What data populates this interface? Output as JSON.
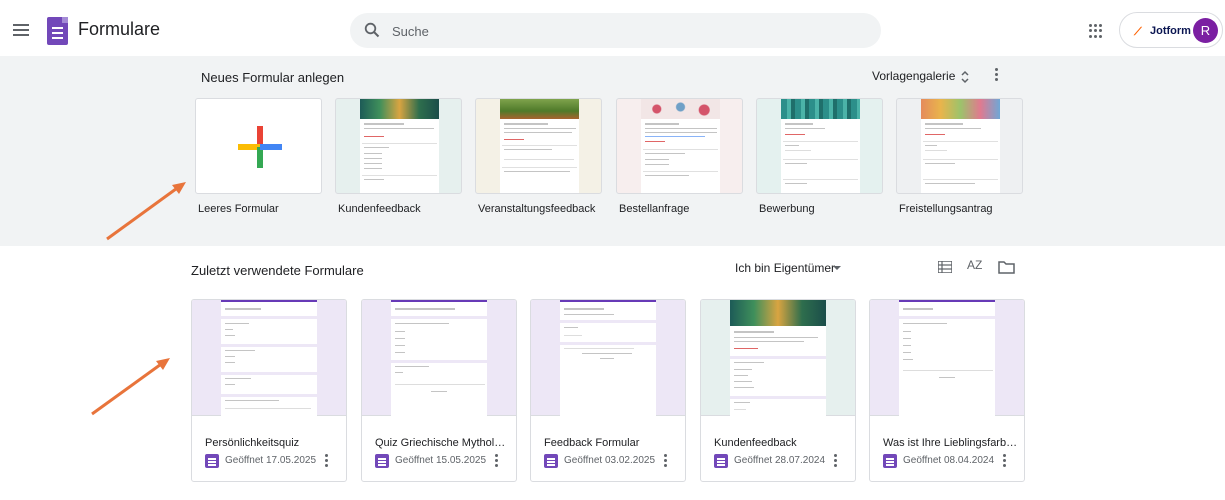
{
  "header": {
    "app_title": "Formulare",
    "search_placeholder": "Suche",
    "jotform_label": "Jotform",
    "avatar_initial": "R"
  },
  "templates": {
    "title": "Neues Formular anlegen",
    "gallery_label": "Vorlagengalerie",
    "items": [
      {
        "label": "Leeres Formular"
      },
      {
        "label": "Kundenfeedback"
      },
      {
        "label": "Veranstaltungsfeedback"
      },
      {
        "label": "Bestellanfrage"
      },
      {
        "label": "Bewerbung"
      },
      {
        "label": "Freistellungsantrag"
      }
    ]
  },
  "recent": {
    "title": "Zuletzt verwendete Formulare",
    "owner_filter": "Ich bin Eigentümer",
    "sort_label": "AZ",
    "forms": [
      {
        "title": "Persönlichkeitsquiz",
        "date": "Geöffnet 17.05.2025"
      },
      {
        "title": "Quiz Griechische Mythol…",
        "date": "Geöffnet 15.05.2025"
      },
      {
        "title": "Feedback Formular",
        "date": "Geöffnet 03.02.2025"
      },
      {
        "title": "Kundenfeedback",
        "date": "Geöffnet 28.07.2024"
      },
      {
        "title": "Was ist Ihre Lieblingsfarbe?",
        "date": "Geöffnet 08.04.2024"
      }
    ]
  },
  "colors": {
    "forms_purple": "#7248b9",
    "annotation_arrow": "#e8743b"
  }
}
